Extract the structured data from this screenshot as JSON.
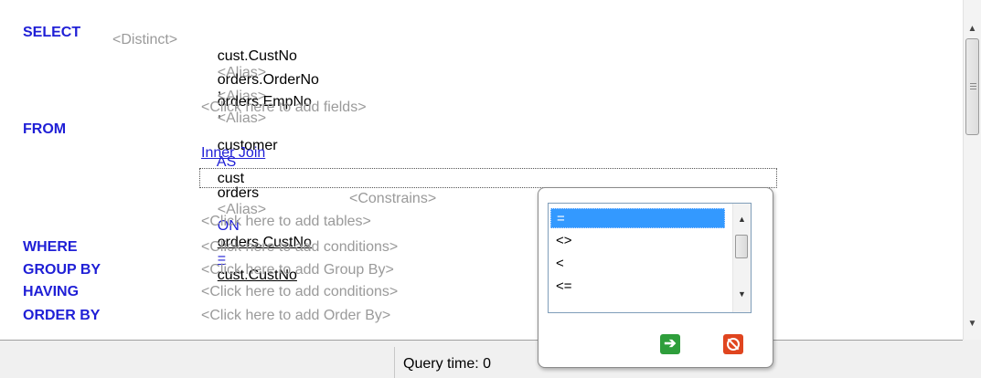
{
  "sql": {
    "select_kw": "SELECT",
    "distinct": "<Distinct>",
    "fields": [
      {
        "name": "cust.CustNo",
        "alias": "<Alias>",
        "sep": ","
      },
      {
        "name": "orders.OrderNo",
        "alias": "<Alias>",
        "sep": ","
      },
      {
        "name": "orders.EmpNo",
        "alias": "<Alias>",
        "sep": ""
      }
    ],
    "add_fields": "<Click here to add fields>",
    "from_kw": "FROM",
    "from_table": "customer",
    "as_kw": "AS",
    "from_alias": "cust",
    "join_type": "Inner Join",
    "join_table": "orders",
    "join_alias": "<Alias>",
    "on_kw": "ON",
    "join_left": "orders.CustNo",
    "join_op": "=",
    "join_right": "cust.CustNo",
    "constrains": "<Constrains>",
    "add_tables": "<Click here to add tables>",
    "where_kw": "WHERE",
    "add_conditions": "<Click here to add conditions>",
    "group_by_kw": "GROUP BY",
    "add_group_by": "<Click here to add Group By>",
    "having_kw": "HAVING",
    "add_having": "<Click here to add conditions>",
    "order_by_kw": "ORDER BY",
    "add_order_by": "<Click here to add Order By>"
  },
  "status": {
    "query_time": "Query time: 0"
  },
  "operator_popup": {
    "options": [
      "=",
      "<>",
      "<",
      "<="
    ],
    "selected": "=",
    "ok_icon": "green-arrow-right-icon",
    "cancel_icon": "red-cancel-icon"
  },
  "colors": {
    "keyword": "#1f1fd6",
    "placeholder": "#9a9a9a",
    "selection": "#3399ff"
  }
}
